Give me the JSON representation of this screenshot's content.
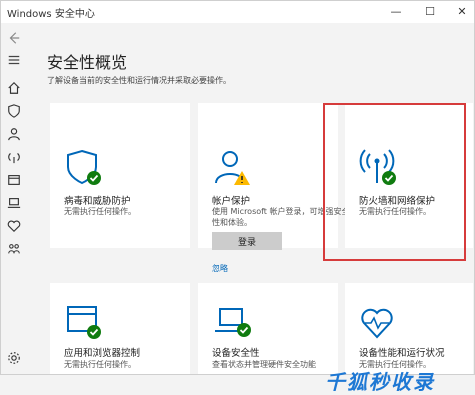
{
  "window": {
    "title": "Windows 安全中心",
    "min": "—",
    "max": "☐",
    "close": "✕"
  },
  "rail": {
    "items": [
      "back-icon",
      "menu-icon",
      "home-icon",
      "shield-icon",
      "account-icon",
      "network-icon",
      "app-browser-icon",
      "device-security-icon",
      "health-icon",
      "family-icon",
      "settings-icon"
    ]
  },
  "page": {
    "title": "安全性概览",
    "subtitle": "了解设备当前的安全性和运行情况并采取必要操作。"
  },
  "cards": [
    {
      "title": "病毒和威胁防护",
      "desc": "无需执行任何操作。",
      "icon": "shield-check-icon"
    },
    {
      "title": "帐户保护",
      "desc": "使用 Microsoft 帐户登录，可增强安全性和体验。",
      "icon": "account-warning-icon",
      "button": "登录",
      "link": "忽略"
    },
    {
      "title": "防火墙和网络保护",
      "desc": "无需执行任何操作。",
      "icon": "wifi-check-icon"
    },
    {
      "title": "应用和浏览器控制",
      "desc": "无需执行任何操作。",
      "icon": "browser-check-icon"
    },
    {
      "title": "设备安全性",
      "desc": "查看状态并管理硬件安全功能",
      "icon": "laptop-check-icon"
    },
    {
      "title": "设备性能和运行状况",
      "desc": "无需执行任何操作。",
      "icon": "heart-monitor-icon"
    }
  ],
  "watermark": "千狐秒收录",
  "colors": {
    "accent": "#0067b8",
    "ok": "#107c10",
    "warn": "#fcb900",
    "highlight": "#d63b3b"
  }
}
